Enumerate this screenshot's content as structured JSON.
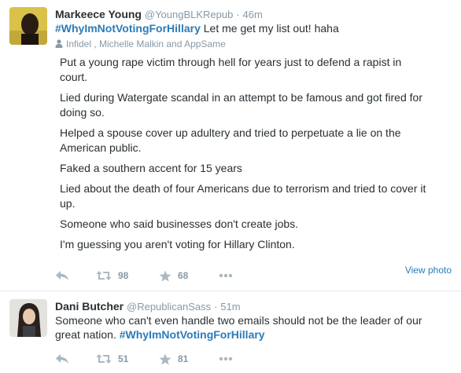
{
  "colors": {
    "link": "#2b7bb9",
    "muted": "#8899a6",
    "icon": "#aab8c2",
    "text": "#292f33"
  },
  "tweets": [
    {
      "fullname": "Markeece Young",
      "handle": "@YoungBLKRepub",
      "dot": "·",
      "time": "46m",
      "hashtag": "#WhyImNotVotingForHillary",
      "text_after": " Let me get my list out! haha",
      "context_icon": "person-icon",
      "context": "Infidel , Michelle Malkin and AppSame",
      "card_lines": [
        "Put a young rape victim through hell for years just to defend a rapist in court.",
        "Lied during Watergate scandal in an attempt to be famous and got fired for doing so.",
        "Helped a spouse cover up adultery and tried to perpetuate a lie on the American public.",
        "Faked a southern accent for 15 years",
        "Lied about the death of four Americans due to terrorism and tried to cover it up.",
        "Someone who said businesses don't create jobs.",
        "I'm guessing you aren't voting for Hillary Clinton."
      ],
      "retweets": "98",
      "favorites": "68",
      "view_photo": "View photo"
    },
    {
      "fullname": "Dani Butcher",
      "handle": "@RepublicanSass",
      "dot": "·",
      "time": "51m",
      "text_before": "Someone who can't even handle two emails should not be the leader of our great nation. ",
      "hashtag": "#WhyImNotVotingForHillary",
      "retweets": "51",
      "favorites": "81"
    }
  ],
  "icons": {
    "reply": "reply-icon",
    "retweet": "retweet-icon",
    "favorite": "star-icon",
    "more": "more-icon"
  }
}
